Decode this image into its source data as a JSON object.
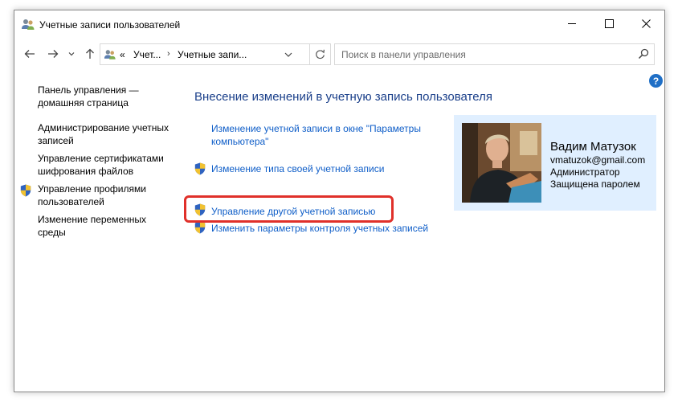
{
  "window": {
    "title": "Учетные записи пользователей",
    "controls": {
      "minimize": "minimize",
      "maximize": "maximize",
      "close": "close"
    }
  },
  "navigation": {
    "breadcrumb_overflow": "«",
    "breadcrumb": [
      "Учет...",
      "Учетные запи..."
    ],
    "breadcrumb_separator": "›",
    "search_placeholder": "Поиск в панели управления"
  },
  "help": {
    "label": "?"
  },
  "sidebar": {
    "home": "Панель управления — домашняя страница",
    "items": [
      "Администрирование учетных записей",
      "Управление сертификатами шифрования файлов",
      "Управление профилями пользователей",
      "Изменение переменных среды"
    ]
  },
  "main": {
    "title": "Внесение изменений в учетную запись пользователя",
    "tasks": [
      "Изменение учетной записи в окне \"Параметры компьютера\"",
      "Изменение типа своей учетной записи",
      "Управление другой учетной записью",
      "Изменить параметры контроля учетных записей"
    ]
  },
  "user": {
    "name": "Вадим Матузок",
    "email": "vmatuzok@gmail.com",
    "role": "Администратор",
    "password_status": "Защищена паролем"
  },
  "colors": {
    "link": "#0f5ec8",
    "title": "#1a3f8a",
    "card_bg": "#e0efff",
    "highlight": "#e0302a",
    "help": "#1f6fc6"
  },
  "icons": [
    "users-icon",
    "shield-icon",
    "search-icon",
    "refresh-icon",
    "back-arrow-icon",
    "forward-arrow-icon",
    "up-arrow-icon",
    "chevron-down-icon",
    "help-icon"
  ]
}
